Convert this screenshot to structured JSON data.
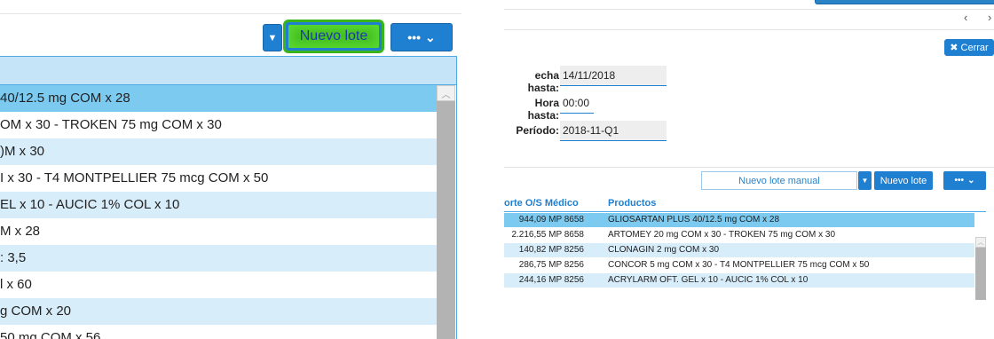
{
  "left_panel": {
    "buttons": {
      "dropdown_icon": "caret-down-icon",
      "nuevo_lote": "Nuevo lote",
      "more_icon": "ellipsis-icon",
      "more_chevron": "chevron-down-icon"
    },
    "rows": [
      "40/12.5 mg COM x 28",
      "OM x 30 - TROKEN 75 mg COM x 30",
      ")M x 30",
      "I x 30 - T4 MONTPELLIER 75 mcg COM x 50",
      "EL x 10 - AUCIC 1% COL x 10",
      "M x 28",
      ": 3,5",
      "l x 60",
      "g COM x 20",
      "50 mg COM x 56"
    ]
  },
  "right_panel": {
    "nav": {
      "prev": "‹",
      "next": "›"
    },
    "cerrar": "Cerrar",
    "form": {
      "fecha_hasta_label": "echa hasta:",
      "fecha_hasta_value": "14/11/2018",
      "hora_hasta_label": "Hora hasta:",
      "hora_hasta_value": "00:00",
      "periodo_label": "Período:",
      "periodo_value": "2018-11-Q1"
    },
    "toolbar": {
      "nuevo_lote_manual": "Nuevo lote manual",
      "nuevo_lote": "Nuevo lote"
    },
    "table": {
      "headers": [
        "orte O/S Médico",
        "Productos"
      ],
      "rows": [
        [
          "944,09 MP 8658",
          "GLIOSARTAN PLUS 40/12.5 mg COM x 28"
        ],
        [
          "2.216,55 MP 8658",
          "ARTOMEY 20 mg COM x 30 - TROKEN 75 mg COM x 30"
        ],
        [
          "140,82 MP 8256",
          "CLONAGIN 2 mg COM x 30"
        ],
        [
          "286,75 MP 8256",
          "CONCOR 5 mg COM x 30 - T4 MONTPELLIER 75 mcg COM x 50"
        ],
        [
          "244,16 MP 8256",
          "ACRYLARM OFT. GEL x 10 - AUCIC 1% COL x 10"
        ]
      ]
    }
  }
}
